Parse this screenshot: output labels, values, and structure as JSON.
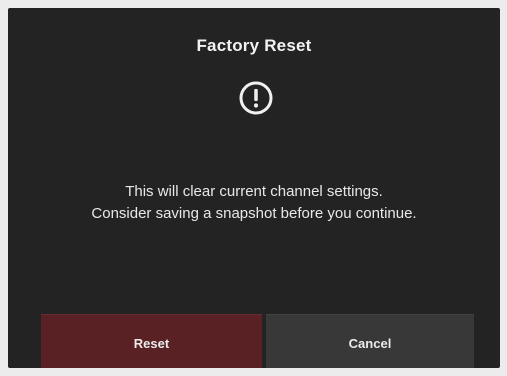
{
  "dialog": {
    "title": "Factory Reset",
    "icon": "exclamation-circle-icon",
    "message_lines": [
      "This will clear current channel settings.",
      "Consider saving a snapshot before you continue."
    ],
    "buttons": {
      "reset_label": "Reset",
      "cancel_label": "Cancel"
    },
    "colors": {
      "background": "#232323",
      "reset_button": "#5a2124",
      "cancel_button": "#383838",
      "text": "#f2f2f2"
    }
  }
}
